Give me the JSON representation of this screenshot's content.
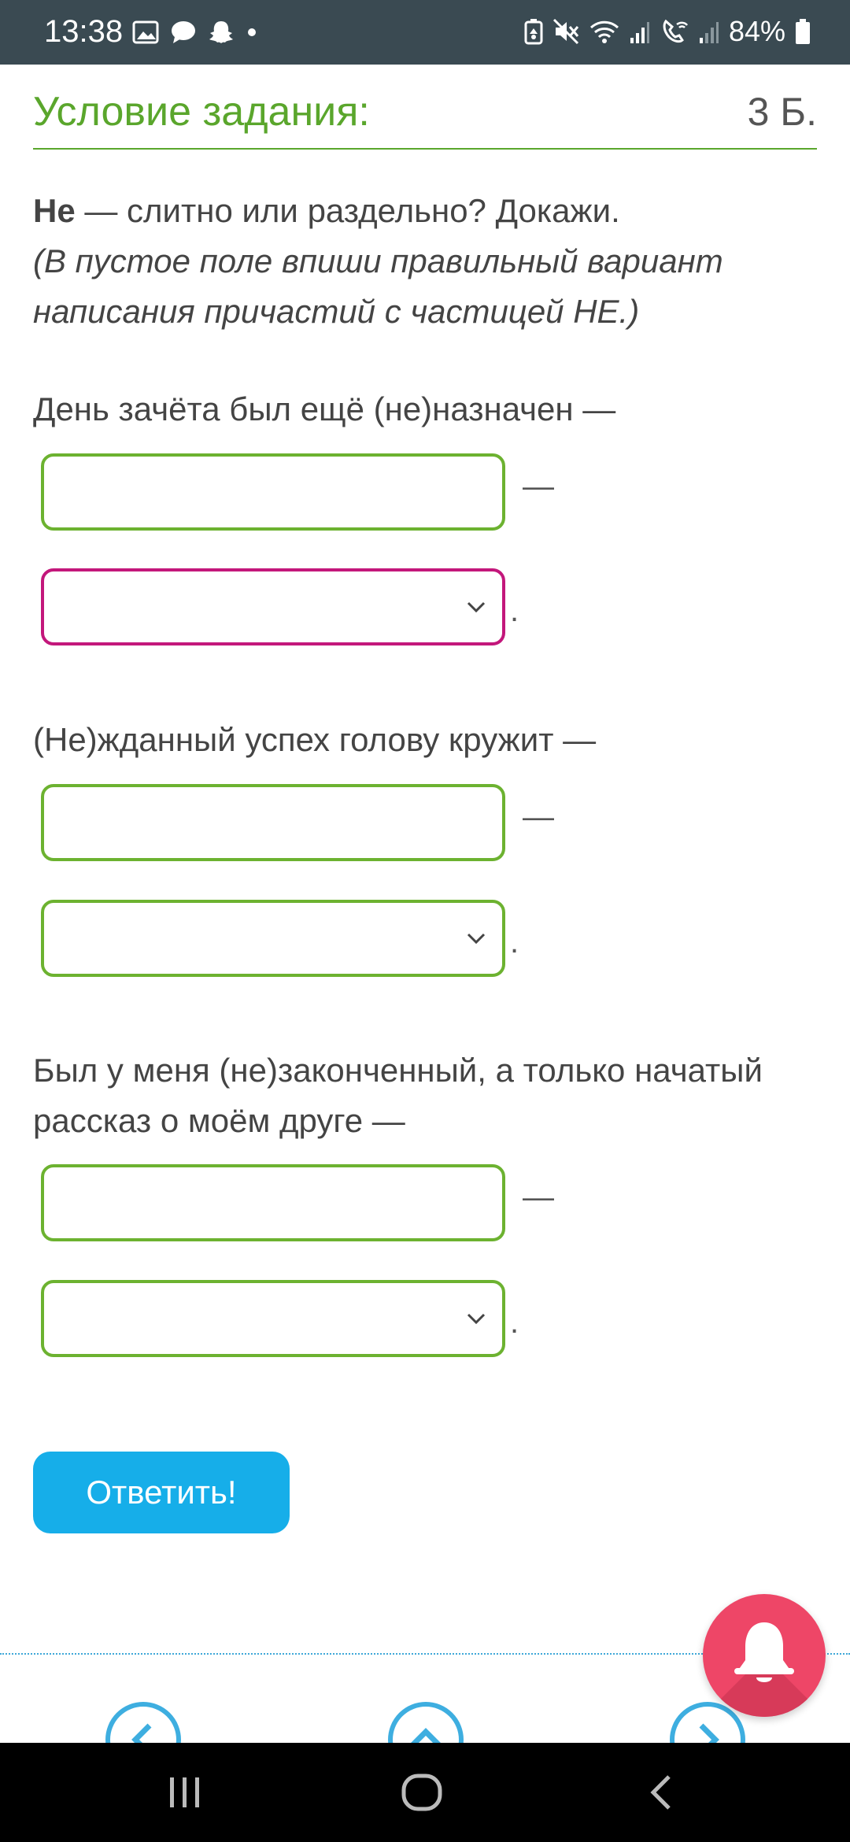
{
  "status_bar": {
    "time": "13:38",
    "left_icons": [
      "image-icon",
      "chat-icon",
      "snapchat-icon",
      "dot-icon"
    ],
    "right_icons": [
      "battery-saver-icon",
      "mute-icon",
      "wifi-icon",
      "signal-icon",
      "wifi-calling-icon",
      "signal-2-icon"
    ],
    "battery": "84%"
  },
  "header": {
    "title": "Условие задания:",
    "points": "3 Б."
  },
  "instructions": {
    "bold": "Не",
    "rest": " — слитно или раздельно? Докажи.",
    "hint": "(В пустое поле впиши правильный вариант написания причастий с частицей НЕ.)"
  },
  "questions": [
    {
      "sentence": "День зачёта был ещё (не)назначен —",
      "input_value": "",
      "select_value": "",
      "dash": "—",
      "period": "."
    },
    {
      "sentence": "(Не)жданный успех голову кружит —",
      "input_value": "",
      "select_value": "",
      "dash": "—",
      "period": "."
    },
    {
      "sentence": "Был у меня (не)законченный, а только начатый рассказ о моём друге —",
      "input_value": "",
      "select_value": "",
      "dash": "—",
      "period": "."
    }
  ],
  "submit_label": "Ответить!",
  "colors": {
    "accent_green": "#5aa62c",
    "field_green": "#6cb230",
    "field_active": "#c3177b",
    "button_blue": "#16aee9",
    "bell_red": "#ee4667"
  }
}
